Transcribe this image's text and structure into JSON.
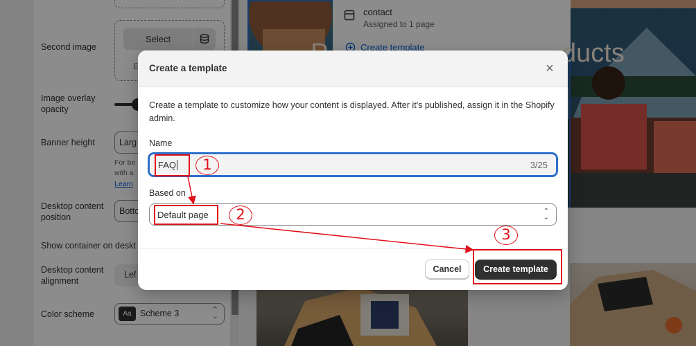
{
  "settings": {
    "second_image_label": "Second image",
    "select_button": "Select",
    "second_image_hint_partial": "E",
    "image_overlay_label": "Image overlay opacity",
    "banner_height_label": "Banner height",
    "banner_height_value": "Larg",
    "banner_height_hint_1": "For be",
    "banner_height_hint_2": "with a",
    "banner_height_link": "Learn",
    "desktop_position_label": "Desktop content position",
    "desktop_position_value": "Botto",
    "show_container_label": "Show container on deskt",
    "desktop_alignment_label": "Desktop content alignment",
    "desktop_alignment_value": "Lef",
    "color_scheme_label": "Color scheme",
    "color_scheme_swatch": "Aa",
    "color_scheme_value": "Scheme 3"
  },
  "preview": {
    "template_name": "contact",
    "template_assigned": "Assigned to 1 page",
    "create_template_link": "Create template",
    "banner_heading_left": "P",
    "banner_heading_right": "ducts"
  },
  "modal": {
    "title": "Create a template",
    "description": "Create a template to customize how your content is displayed. After it's published, assign it in the Shopify admin.",
    "name_label": "Name",
    "name_value": "FAQ",
    "name_counter": "3/25",
    "based_on_label": "Based on",
    "based_on_value": "Default page",
    "cancel_button": "Cancel",
    "create_button": "Create template"
  },
  "annotations": {
    "step_1": "1",
    "step_2": "2",
    "step_3": "3",
    "color": "#e0101a"
  },
  "colors": {
    "accent_blue": "#2c6ecb",
    "primary_button": "#303030",
    "link": "#005bd3"
  }
}
